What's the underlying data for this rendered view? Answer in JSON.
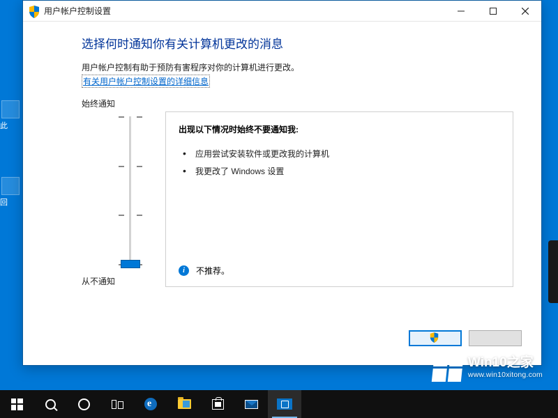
{
  "window": {
    "title": "用户帐户控制设置"
  },
  "page": {
    "heading": "选择何时通知你有关计算机更改的消息",
    "description": "用户帐户控制有助于预防有害程序对你的计算机进行更改。",
    "link": "有关用户帐户控制设置的详细信息"
  },
  "slider": {
    "top_label": "始终通知",
    "bottom_label": "从不通知",
    "levels": 4,
    "selected_index": 3
  },
  "panel": {
    "heading": "出现以下情况时始终不要通知我:",
    "items": [
      "应用尝试安装软件或更改我的计算机",
      "我更改了 Windows 设置"
    ],
    "footer_text": "不推荐。"
  },
  "buttons": {
    "ok": "",
    "cancel": ""
  },
  "watermark": {
    "line1": "Win10之家",
    "line2": "www.win10xitong.com"
  },
  "taskbar": {
    "items": [
      "start",
      "search",
      "cortana",
      "taskview",
      "edge",
      "explorer",
      "store",
      "mail",
      "control-panel"
    ]
  }
}
